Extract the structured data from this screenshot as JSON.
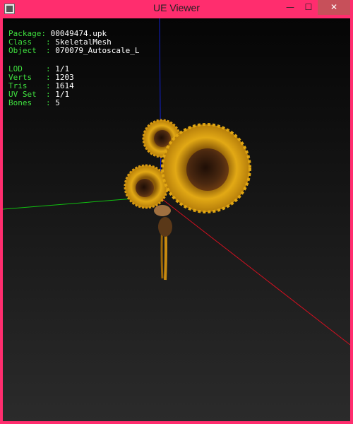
{
  "window": {
    "title": "UE Viewer",
    "minimize_glyph": "—",
    "maximize_glyph": "☐",
    "close_glyph": "✕",
    "frame_color": "#ff2d6e",
    "close_color": "#c7505a"
  },
  "info": {
    "package_label": "Package: ",
    "package_value": "00049474.upk",
    "class_label": "Class   : ",
    "class_value": "SkeletalMesh",
    "object_label": "Object  : ",
    "object_value": "070079_Autoscale_L",
    "lod_label": "LOD     : ",
    "lod_value": "1/1",
    "verts_label": "Verts   : ",
    "verts_value": "1203",
    "tris_label": "Tris    : ",
    "tris_value": "1614",
    "uvset_label": "UV Set  : ",
    "uvset_value": "1/1",
    "bones_label": "Bones   : ",
    "bones_value": "5"
  },
  "scene": {
    "model": "sunflower-bouquet",
    "axis_x_color": "#d01020",
    "axis_y_color": "#10c010",
    "axis_z_color": "#1020d0",
    "label_color": "#3fe03f",
    "petal_color": "#d9a21a",
    "center_color": "#3a1e0e"
  }
}
